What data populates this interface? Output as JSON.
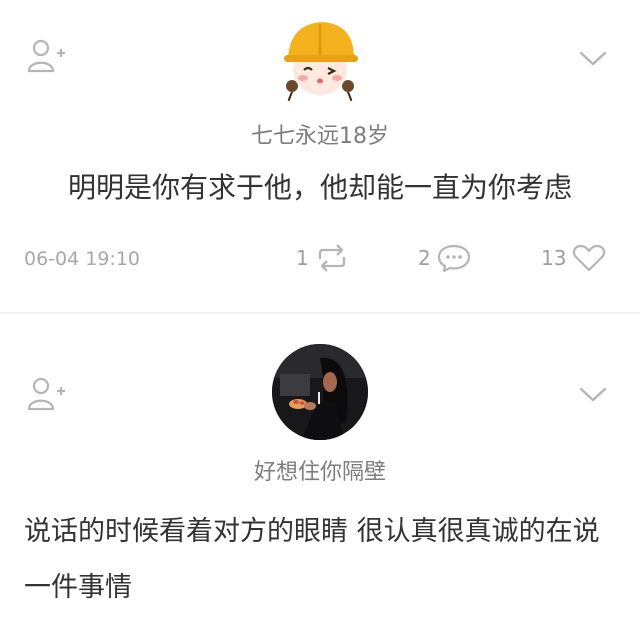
{
  "posts": [
    {
      "username": "七七永远18岁",
      "content": "明明是你有求于他，他却能一直为你考虑",
      "time": "06-04 19:10",
      "reposts": "1",
      "comments": "2",
      "likes": "13"
    },
    {
      "username": "好想住你隔壁",
      "content": "说话的时候看着对方的眼睛 很认真很真诚的在说一件事情"
    }
  ],
  "icons": {
    "follow": "person-plus-icon",
    "more": "chevron-down-icon",
    "repost": "repost-icon",
    "comment": "comment-icon",
    "like": "heart-icon"
  },
  "colors": {
    "icon_gray": "#b5b5b5",
    "text_main": "#333333",
    "text_muted": "#7d7d7d",
    "helmet_yellow": "#f4b21c"
  }
}
